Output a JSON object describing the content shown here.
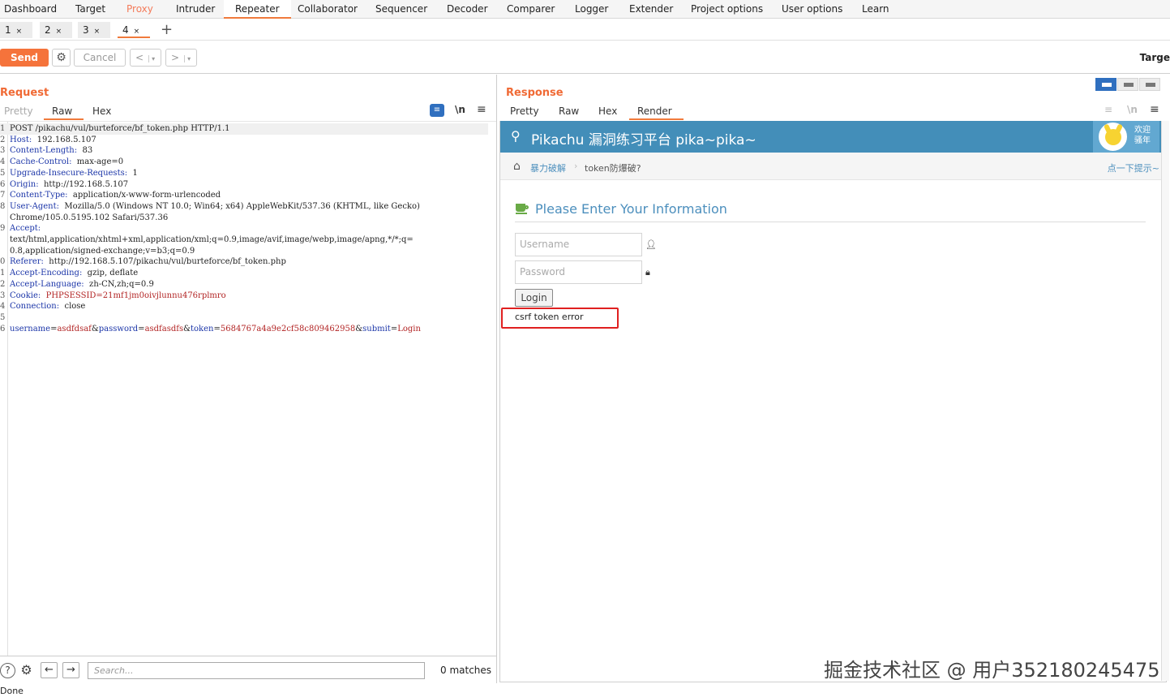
{
  "nav": {
    "tabs": [
      {
        "label": "Dashboard"
      },
      {
        "label": "Target"
      },
      {
        "label": "Proxy"
      },
      {
        "label": "Intruder"
      },
      {
        "label": "Repeater"
      },
      {
        "label": "Collaborator"
      },
      {
        "label": "Sequencer"
      },
      {
        "label": "Decoder"
      },
      {
        "label": "Comparer"
      },
      {
        "label": "Logger"
      },
      {
        "label": "Extender"
      },
      {
        "label": "Project options"
      },
      {
        "label": "User options"
      },
      {
        "label": "Learn"
      }
    ],
    "active": "Repeater"
  },
  "repeater_tabs": [
    {
      "label": "1",
      "close": "×"
    },
    {
      "label": "2",
      "close": "×"
    },
    {
      "label": "3",
      "close": "×"
    },
    {
      "label": "4",
      "close": "×"
    }
  ],
  "add_tab": "+",
  "toolbar": {
    "send": "Send",
    "cancel": "Cancel",
    "back": "<",
    "forward": ">",
    "dropdown": "▾",
    "target": "Targe"
  },
  "request": {
    "title": "Request",
    "views": {
      "pretty": "Pretty",
      "raw": "Raw",
      "hex": "Hex"
    },
    "newline_toggle": "\\n",
    "lines": [
      {
        "n": "1",
        "name": "",
        "value": "POST /pikachu/vul/burteforce/bf_token.php HTTP/1.1"
      },
      {
        "n": "2",
        "name": "Host",
        "value": "  192.168.5.107"
      },
      {
        "n": "3",
        "name": "Content-Length",
        "value": "  83"
      },
      {
        "n": "4",
        "name": "Cache-Control",
        "value": "  max-age=0"
      },
      {
        "n": "5",
        "name": "Upgrade-Insecure-Requests",
        "value": "  1"
      },
      {
        "n": "6",
        "name": "Origin",
        "value": "  http://192.168.5.107"
      },
      {
        "n": "7",
        "name": "Content-Type",
        "value": "  application/x-www-form-urlencoded"
      },
      {
        "n": "8",
        "name": "User-Agent",
        "value": "  Mozilla/5.0 (Windows NT 10.0; Win64; x64) AppleWebKit/537.36 (KHTML, like Gecko)"
      },
      {
        "n": "",
        "name": "",
        "value": "Chrome/105.0.5195.102 Safari/537.36"
      },
      {
        "n": "9",
        "name": "Accept",
        "value": ""
      },
      {
        "n": "",
        "name": "",
        "value": "text/html,application/xhtml+xml,application/xml;q=0.9,image/avif,image/webp,image/apng,*/*;q="
      },
      {
        "n": "",
        "name": "",
        "value": "0.8,application/signed-exchange;v=b3;q=0.9"
      },
      {
        "n": "0",
        "name": "Referer",
        "value": "  http://192.168.5.107/pikachu/vul/burteforce/bf_token.php"
      },
      {
        "n": "1",
        "name": "Accept-Encoding",
        "value": "  gzip, deflate"
      },
      {
        "n": "2",
        "name": "Accept-Language",
        "value": "  zh-CN,zh;q=0.9"
      },
      {
        "n": "3",
        "name": "Cookie",
        "value": "  PHPSESSID=21mf1jm0oivjlunnu476rplmro"
      },
      {
        "n": "4",
        "name": "Connection",
        "value": "  close"
      },
      {
        "n": "5",
        "name": "",
        "value": ""
      },
      {
        "n": "6",
        "name": "",
        "value": ""
      }
    ],
    "body": [
      {
        "key": "username",
        "eq": "=",
        "val": "asdfdsaf",
        "amp": "&"
      },
      {
        "key": "password",
        "eq": "=",
        "val": "asdfasdfs",
        "amp": "&"
      },
      {
        "key": "token",
        "eq": "=",
        "val": "5684767a4a9e2cf58c809462958",
        "amp": "&"
      },
      {
        "key": "submit",
        "eq": "=",
        "val": "Login",
        "amp": ""
      }
    ],
    "search_placeholder": "Search...",
    "matches": "0 matches"
  },
  "response": {
    "title": "Response",
    "views": {
      "pretty": "Pretty",
      "raw": "Raw",
      "hex": "Hex",
      "render": "Render"
    },
    "newline_toggle": "\\n",
    "page": {
      "header_title": "Pikachu 漏洞练习平台 pika~pika~",
      "welcome": "欢迎 骚年",
      "breadcrumb_link": "暴力破解",
      "breadcrumb_sep": "›",
      "breadcrumb_current": "token防爆破?",
      "hint": "点一下提示~",
      "form_title": "Please Enter Your Information",
      "username_placeholder": "Username",
      "password_placeholder": "Password",
      "login": "Login",
      "error": "csrf token error"
    }
  },
  "status": "Done",
  "watermark": "掘金技术社区 @ 用户352180245475"
}
